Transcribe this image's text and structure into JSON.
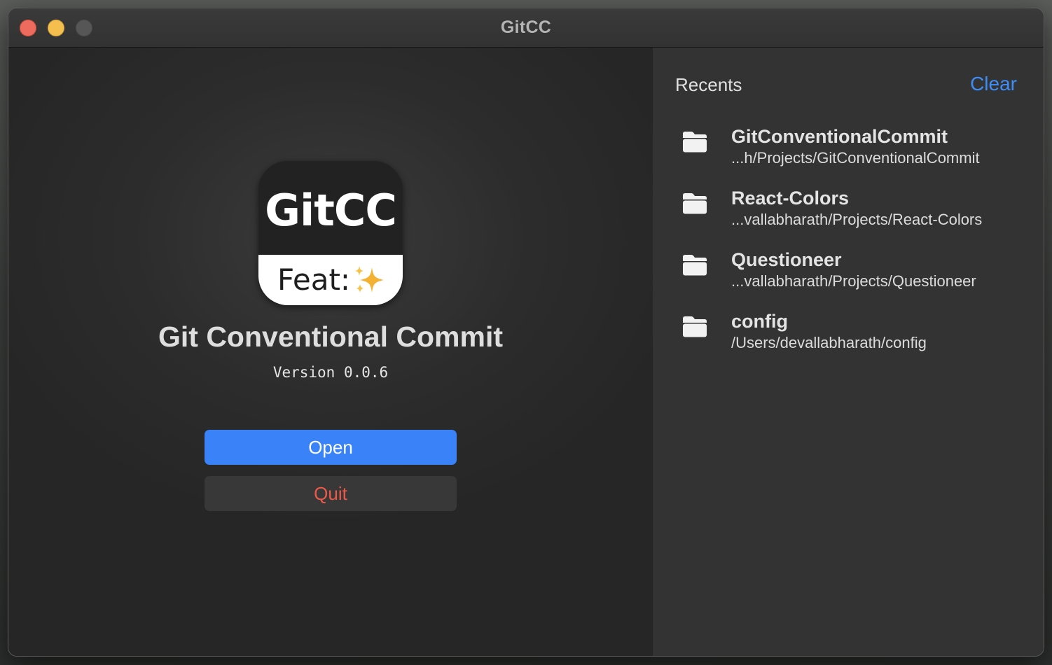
{
  "window": {
    "title": "GitCC"
  },
  "app": {
    "icon_title": "GitCC",
    "icon_subtitle": "Feat:",
    "name": "Git Conventional Commit",
    "version": "Version 0.0.6"
  },
  "actions": {
    "open_label": "Open",
    "quit_label": "Quit"
  },
  "recents": {
    "title": "Recents",
    "clear_label": "Clear",
    "items": [
      {
        "name": "GitConventionalCommit",
        "path": "...h/Projects/GitConventionalCommit",
        "icon": "folder-icon"
      },
      {
        "name": "React-Colors",
        "path": "...vallabharath/Projects/React-Colors",
        "icon": "folder-icon"
      },
      {
        "name": "Questioneer",
        "path": "...vallabharath/Projects/Questioneer",
        "icon": "folder-icon"
      },
      {
        "name": "config",
        "path": "/Users/devallabharath/config",
        "icon": "folder-icon"
      }
    ]
  },
  "colors": {
    "accent": "#3a82f7",
    "link": "#3f8ef7",
    "destructive": "#ec5a4a",
    "traffic_close": "#ed6a5e",
    "traffic_minimize": "#f5bf4f",
    "traffic_zoom_inactive": "#565656"
  }
}
